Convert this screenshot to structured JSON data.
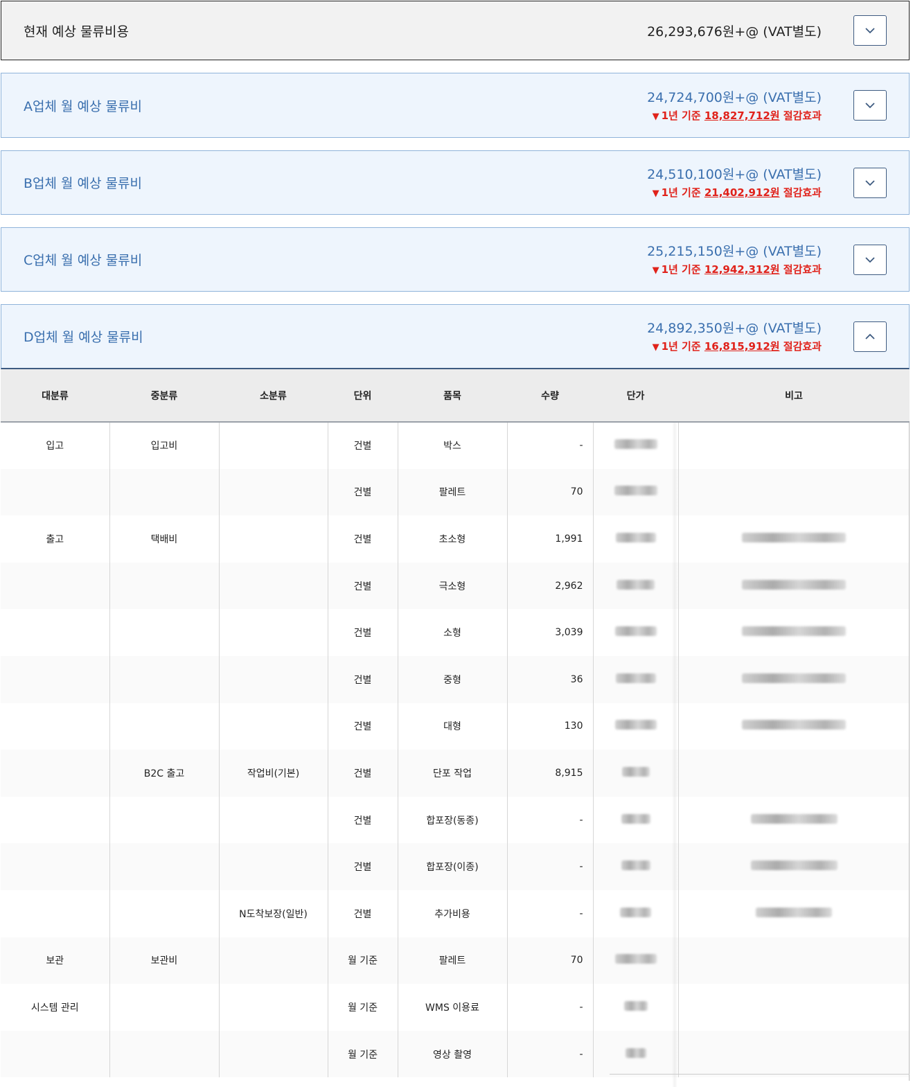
{
  "current": {
    "title": "현재 예상 물류비용",
    "amount": "26,293,676원+@ (VAT별도)"
  },
  "vendors": [
    {
      "title": "A업체 월 예상 물류비",
      "amount": "24,724,700원+@ (VAT별도)",
      "saving_prefix": "1년 기준 ",
      "saving_value": "18,827,712원",
      "saving_suffix": " 절감효과"
    },
    {
      "title": "B업체 월 예상 물류비",
      "amount": "24,510,100원+@ (VAT별도)",
      "saving_prefix": "1년 기준 ",
      "saving_value": "21,402,912원",
      "saving_suffix": " 절감효과"
    },
    {
      "title": "C업체 월 예상 물류비",
      "amount": "25,215,150원+@ (VAT별도)",
      "saving_prefix": "1년 기준 ",
      "saving_value": "12,942,312원",
      "saving_suffix": " 절감효과"
    },
    {
      "title": "D업체 월 예상 물류비",
      "amount": "24,892,350원+@ (VAT별도)",
      "saving_prefix": "1년 기준 ",
      "saving_value": "16,815,912원",
      "saving_suffix": " 절감효과"
    }
  ],
  "table": {
    "headers": [
      "대분류",
      "중분류",
      "소분류",
      "단위",
      "품목",
      "수량",
      "단가",
      "비고"
    ],
    "rows": [
      {
        "major": "입고",
        "middle": "입고비",
        "minor": "",
        "unit": "건별",
        "item": "박스",
        "qty": "-"
      },
      {
        "major": "",
        "middle": "",
        "minor": "",
        "unit": "건별",
        "item": "팔레트",
        "qty": "70"
      },
      {
        "major": "출고",
        "middle": "택배비",
        "minor": "",
        "unit": "건별",
        "item": "초소형",
        "qty": "1,991"
      },
      {
        "major": "",
        "middle": "",
        "minor": "",
        "unit": "건별",
        "item": "극소형",
        "qty": "2,962"
      },
      {
        "major": "",
        "middle": "",
        "minor": "",
        "unit": "건별",
        "item": "소형",
        "qty": "3,039"
      },
      {
        "major": "",
        "middle": "",
        "minor": "",
        "unit": "건별",
        "item": "중형",
        "qty": "36"
      },
      {
        "major": "",
        "middle": "",
        "minor": "",
        "unit": "건별",
        "item": "대형",
        "qty": "130"
      },
      {
        "major": "",
        "middle": "B2C 출고",
        "minor": "작업비(기본)",
        "unit": "건별",
        "item": "단포 작업",
        "qty": "8,915"
      },
      {
        "major": "",
        "middle": "",
        "minor": "",
        "unit": "건별",
        "item": "합포장(동종)",
        "qty": "-"
      },
      {
        "major": "",
        "middle": "",
        "minor": "",
        "unit": "건별",
        "item": "합포장(이종)",
        "qty": "-"
      },
      {
        "major": "",
        "middle": "",
        "minor": "N도착보장(일반)",
        "unit": "건별",
        "item": "추가비용",
        "qty": "-"
      },
      {
        "major": "보관",
        "middle": "보관비",
        "minor": "",
        "unit": "월 기준",
        "item": "팔레트",
        "qty": "70"
      },
      {
        "major": "시스템 관리",
        "middle": "",
        "minor": "",
        "unit": "월 기준",
        "item": "WMS 이용료",
        "qty": "-"
      },
      {
        "major": "",
        "middle": "",
        "minor": "",
        "unit": "월 기준",
        "item": "영상 촬영",
        "qty": "-"
      }
    ]
  },
  "icons": {
    "collapsed": "chevron-down-icon",
    "expanded": "chevron-up-icon"
  },
  "colors": {
    "vendor_text": "#3a6fae",
    "saving_red": "#e0221a",
    "panel_bg": "#eef5fd"
  }
}
